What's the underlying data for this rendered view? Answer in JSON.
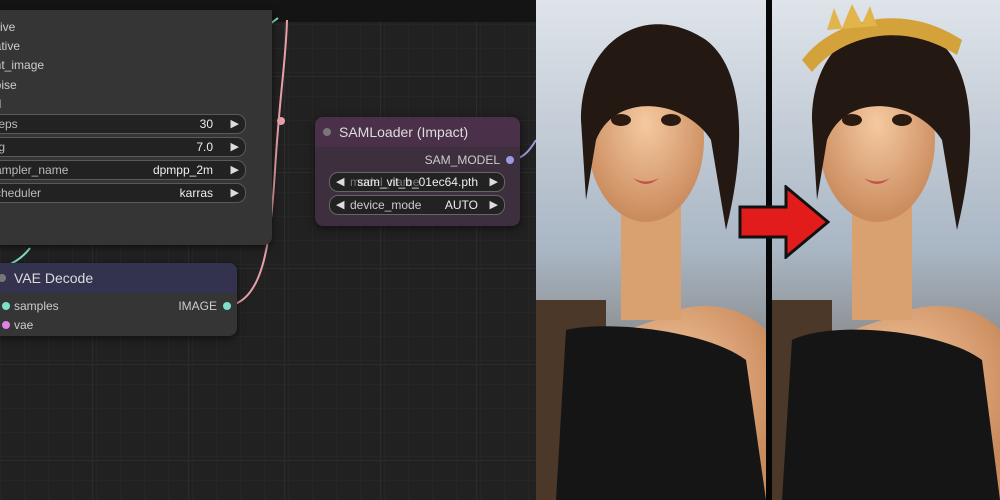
{
  "ksampler": {
    "inputs": [
      "sitive",
      "gative",
      "ent_image",
      "noise",
      "ed"
    ],
    "widgets": [
      {
        "label": "steps",
        "value": "30"
      },
      {
        "label": "cfg",
        "value": "7.0"
      },
      {
        "label": "sampler_name",
        "value": "dpmpp_2m"
      },
      {
        "label": "scheduler",
        "value": "karras"
      }
    ]
  },
  "samloader": {
    "title": "SAMLoader (Impact)",
    "output": "SAM_MODEL",
    "model_name": {
      "label": "model_name",
      "value": "sam_vit_b_01ec64.pth"
    },
    "device_mode": {
      "label": "device_mode",
      "value": "AUTO"
    }
  },
  "vaedecode": {
    "title": "VAE Decode",
    "inputs": [
      "samples",
      "vae"
    ],
    "output": "IMAGE"
  },
  "colors": {
    "canvas": "#212121",
    "node_body": "#353535",
    "sam_title": "#4a3048",
    "vae_title": "#33334f",
    "wire_image": "#e8a0a8",
    "wire_latent": "#7fe0c8",
    "wire_sam": "#9a9ae0",
    "arrow": "#e21b1b"
  },
  "icons": {
    "left_arrow": "◀",
    "right_arrow": "▶"
  }
}
